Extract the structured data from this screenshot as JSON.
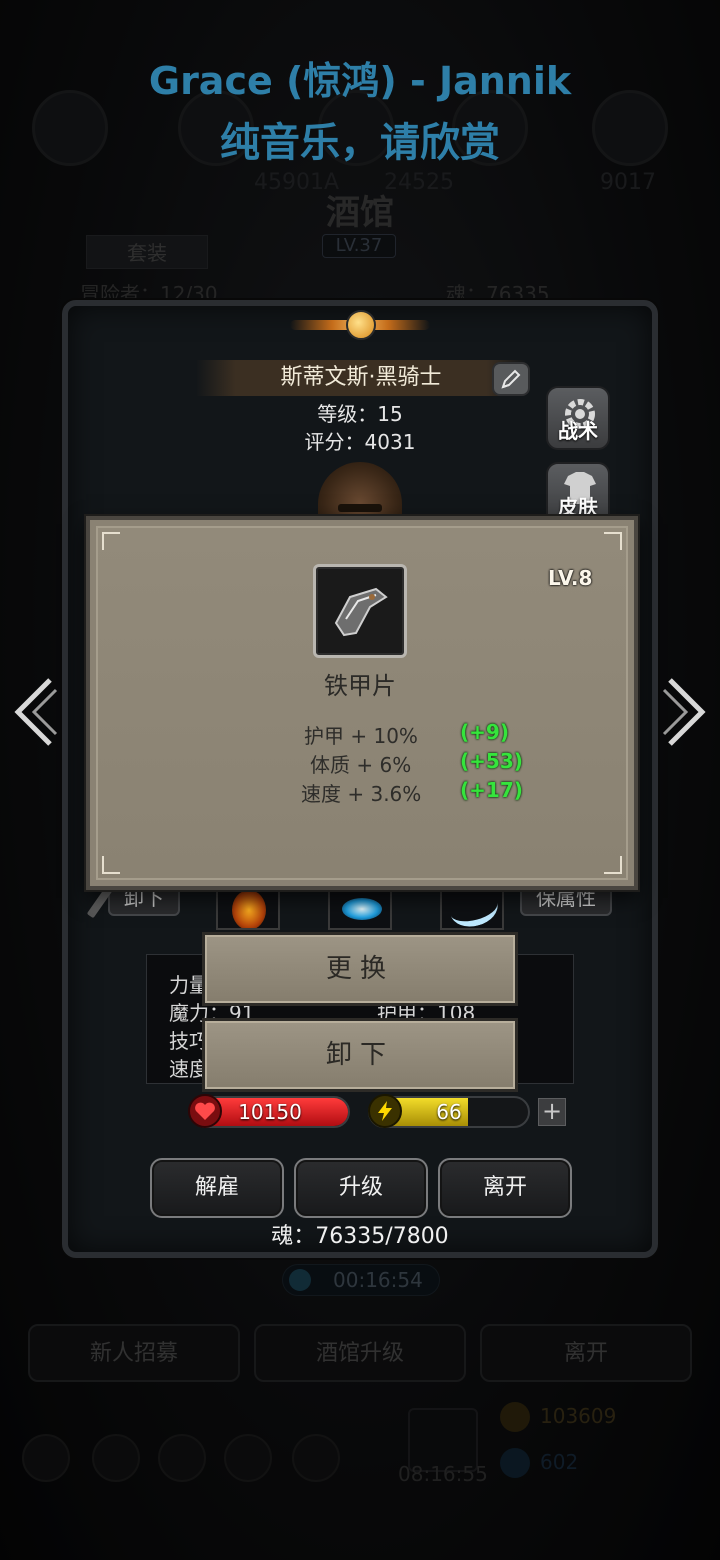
{
  "music": {
    "title": "Grace (惊鸿) - Jannik",
    "subtitle": "纯音乐，请欣赏"
  },
  "background": {
    "tavern_title": "酒馆",
    "tavern_level": "LV.37",
    "tab_suit": "套装",
    "hero_count": "冒险者：12/30",
    "soul": "魂：76335",
    "top_numbers": [
      "45901A",
      "24525",
      "9017"
    ],
    "timer": "00:16:54",
    "bottom_buttons": [
      "新人招募",
      "酒馆升级",
      "离开"
    ],
    "gift_time": "08:16:55",
    "gold": "103609",
    "gems": "602"
  },
  "hero": {
    "name": "斯蒂文斯·黑骑士",
    "level": "等级：15",
    "score": "评分：4031",
    "side_buttons": [
      "战术",
      "皮肤"
    ],
    "left_tag": "卸下",
    "right_tag": "保属性",
    "stats": {
      "strength": "力量",
      "magic": "魔力：91",
      "skill": "技巧",
      "speed": "速度",
      "armor": "护甲：108"
    },
    "hp": "10150",
    "energy": "66",
    "energy_fraction": 0.62,
    "actions": [
      "解雇",
      "升级",
      "离开"
    ],
    "soul_footer": "魂：76335/7800"
  },
  "item_popup": {
    "level": "LV.8",
    "name": "铁甲片",
    "attributes": [
      {
        "label": "护甲 + 10%",
        "bonus": "(+9)"
      },
      {
        "label": "体质 + 6%",
        "bonus": "(+53)"
      },
      {
        "label": "速度 + 3.6%",
        "bonus": "(+17)"
      }
    ],
    "replace_label": "更换",
    "unequip_label": "卸下"
  },
  "colors": {
    "hp_red": "#c8161d",
    "energy_yellow": "#d9c114",
    "bonus_green": "#35e43c",
    "music_blue": "#2e7fa8"
  }
}
